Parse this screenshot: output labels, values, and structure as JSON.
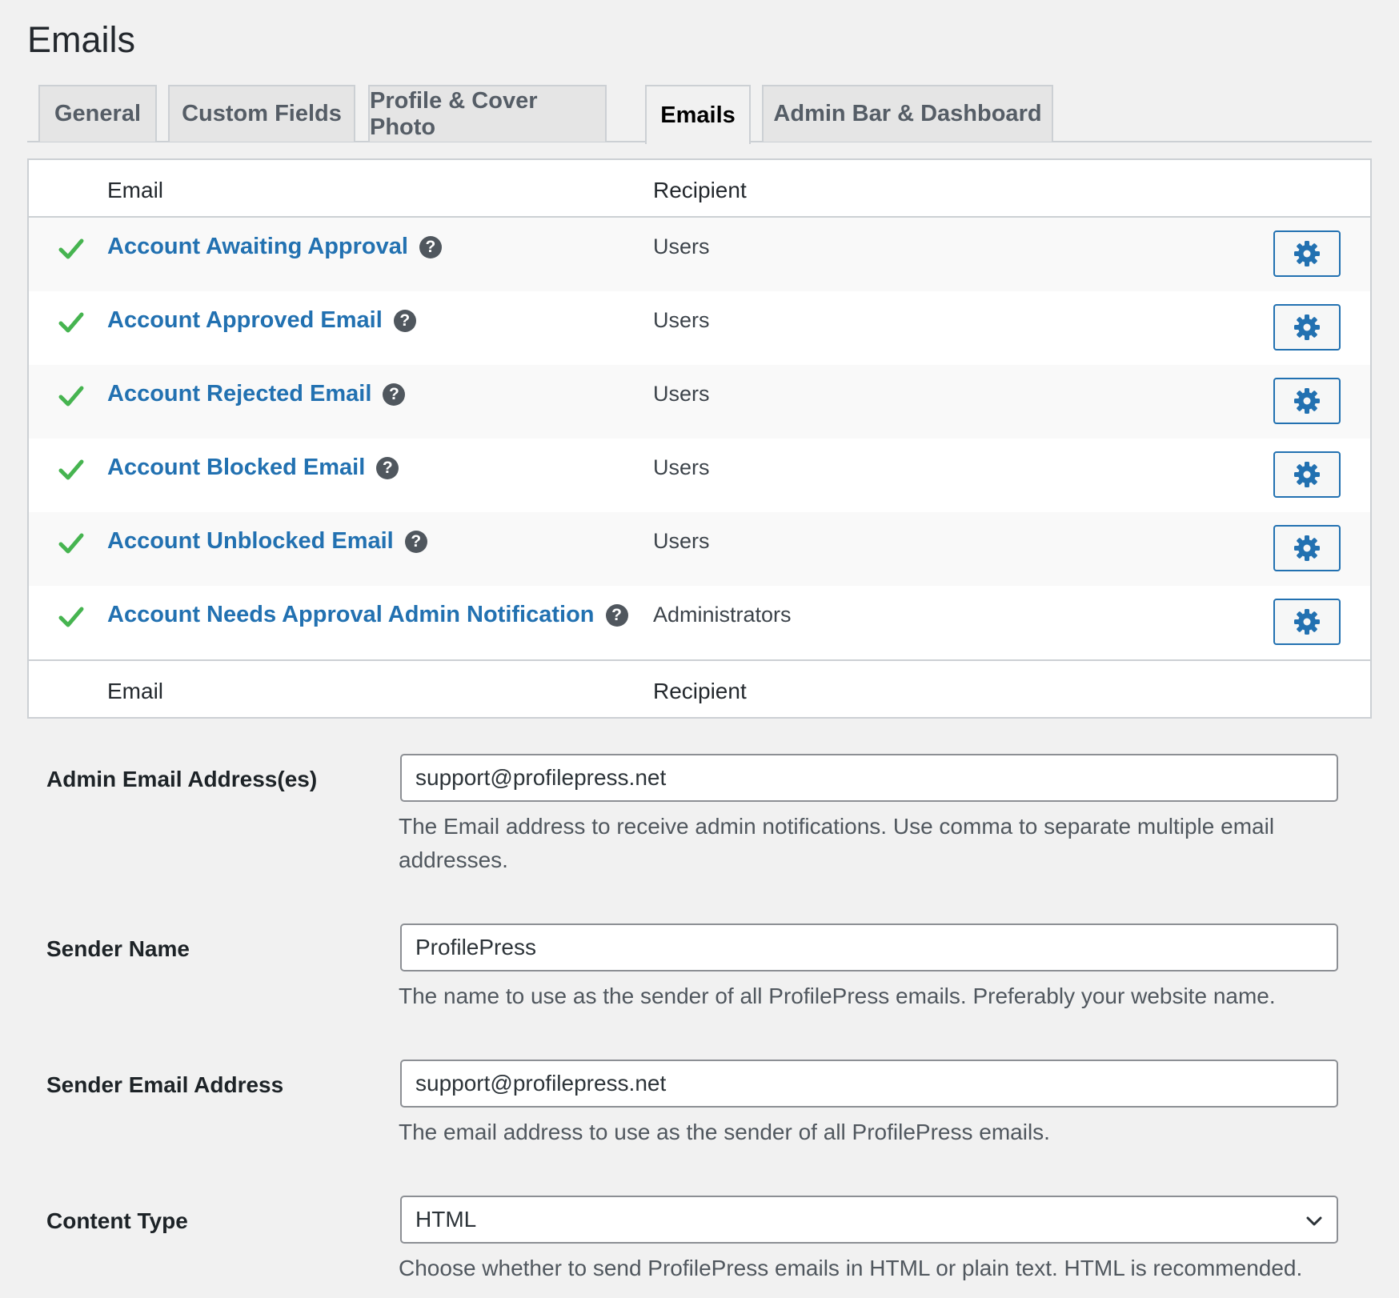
{
  "page": {
    "title": "Emails"
  },
  "tabs": [
    {
      "label": "General"
    },
    {
      "label": "Custom Fields"
    },
    {
      "label": "Profile & Cover Photo"
    },
    {
      "label": "Emails",
      "active": true
    },
    {
      "label": "Admin Bar & Dashboard"
    }
  ],
  "table": {
    "header": {
      "email": "Email",
      "recipient": "Recipient"
    },
    "footer": {
      "email": "Email",
      "recipient": "Recipient"
    },
    "rows": [
      {
        "name": "Account Awaiting Approval",
        "recipient": "Users",
        "enabled": true
      },
      {
        "name": "Account Approved Email",
        "recipient": "Users",
        "enabled": true
      },
      {
        "name": "Account Rejected Email",
        "recipient": "Users",
        "enabled": true
      },
      {
        "name": "Account Blocked Email",
        "recipient": "Users",
        "enabled": true
      },
      {
        "name": "Account Unblocked Email",
        "recipient": "Users",
        "enabled": true
      },
      {
        "name": "Account Needs Approval Admin Notification",
        "recipient": "Administrators",
        "enabled": true
      }
    ],
    "help_glyph": "?"
  },
  "form": {
    "admin_email": {
      "label": "Admin Email Address(es)",
      "value": "support@profilepress.net",
      "description": "The Email address to receive admin notifications. Use comma to separate multiple email addresses."
    },
    "sender_name": {
      "label": "Sender Name",
      "value": "ProfilePress",
      "description": "The name to use as the sender of all ProfilePress emails. Preferably your website name."
    },
    "sender_email": {
      "label": "Sender Email Address",
      "value": "support@profilepress.net",
      "description": "The email address to use as the sender of all ProfilePress emails."
    },
    "content_type": {
      "label": "Content Type",
      "value": "HTML",
      "description": "Choose whether to send ProfilePress emails in HTML or plain text. HTML is recommended."
    }
  },
  "colors": {
    "link": "#2271b1",
    "check": "#46b450",
    "border": "#ccd0d4",
    "background": "#f1f1f1"
  },
  "icons": {
    "status": "check-icon",
    "help": "help-icon",
    "settings": "gear-icon",
    "select": "chevron-down-icon"
  }
}
